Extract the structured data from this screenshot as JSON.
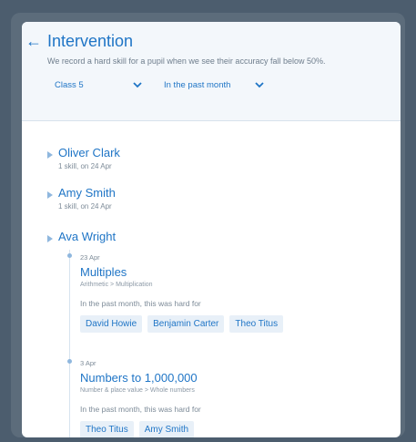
{
  "header": {
    "back_icon": "←",
    "title": "Intervention",
    "subtitle": "We record a hard skill for a pupil when we see their accuracy fall below 50%.",
    "class_select": "Class 5",
    "period_select": "In the past month"
  },
  "pupils": [
    {
      "name": "Oliver Clark",
      "meta": "1 skill, on 24 Apr"
    },
    {
      "name": "Amy Smith",
      "meta": "1 skill, on 24 Apr"
    },
    {
      "name": "Ava Wright"
    }
  ],
  "ava_entries": [
    {
      "date": "23 Apr",
      "skill": "Multiples",
      "path": "Arithmetic > Multiplication",
      "hard_for": "In the past month, this was hard for",
      "pupils": [
        "David Howie",
        "Benjamin Carter",
        "Theo Titus"
      ]
    },
    {
      "date": "3 Apr",
      "skill": "Numbers to 1,000,000",
      "path": "Number & place value > Whole numbers",
      "hard_for": "In the past month, this was hard for",
      "pupils": [
        "Theo Titus",
        "Amy Smith"
      ]
    }
  ],
  "colors": {
    "accent": "#1f75c6",
    "chip_bg": "#e8f0f8",
    "background": "#4c5d6e"
  },
  "icons": {
    "back": "back-arrow-icon",
    "chevron": "chevron-down-icon",
    "expand": "triangle-right-icon",
    "timeline_dot": "dot-icon"
  }
}
